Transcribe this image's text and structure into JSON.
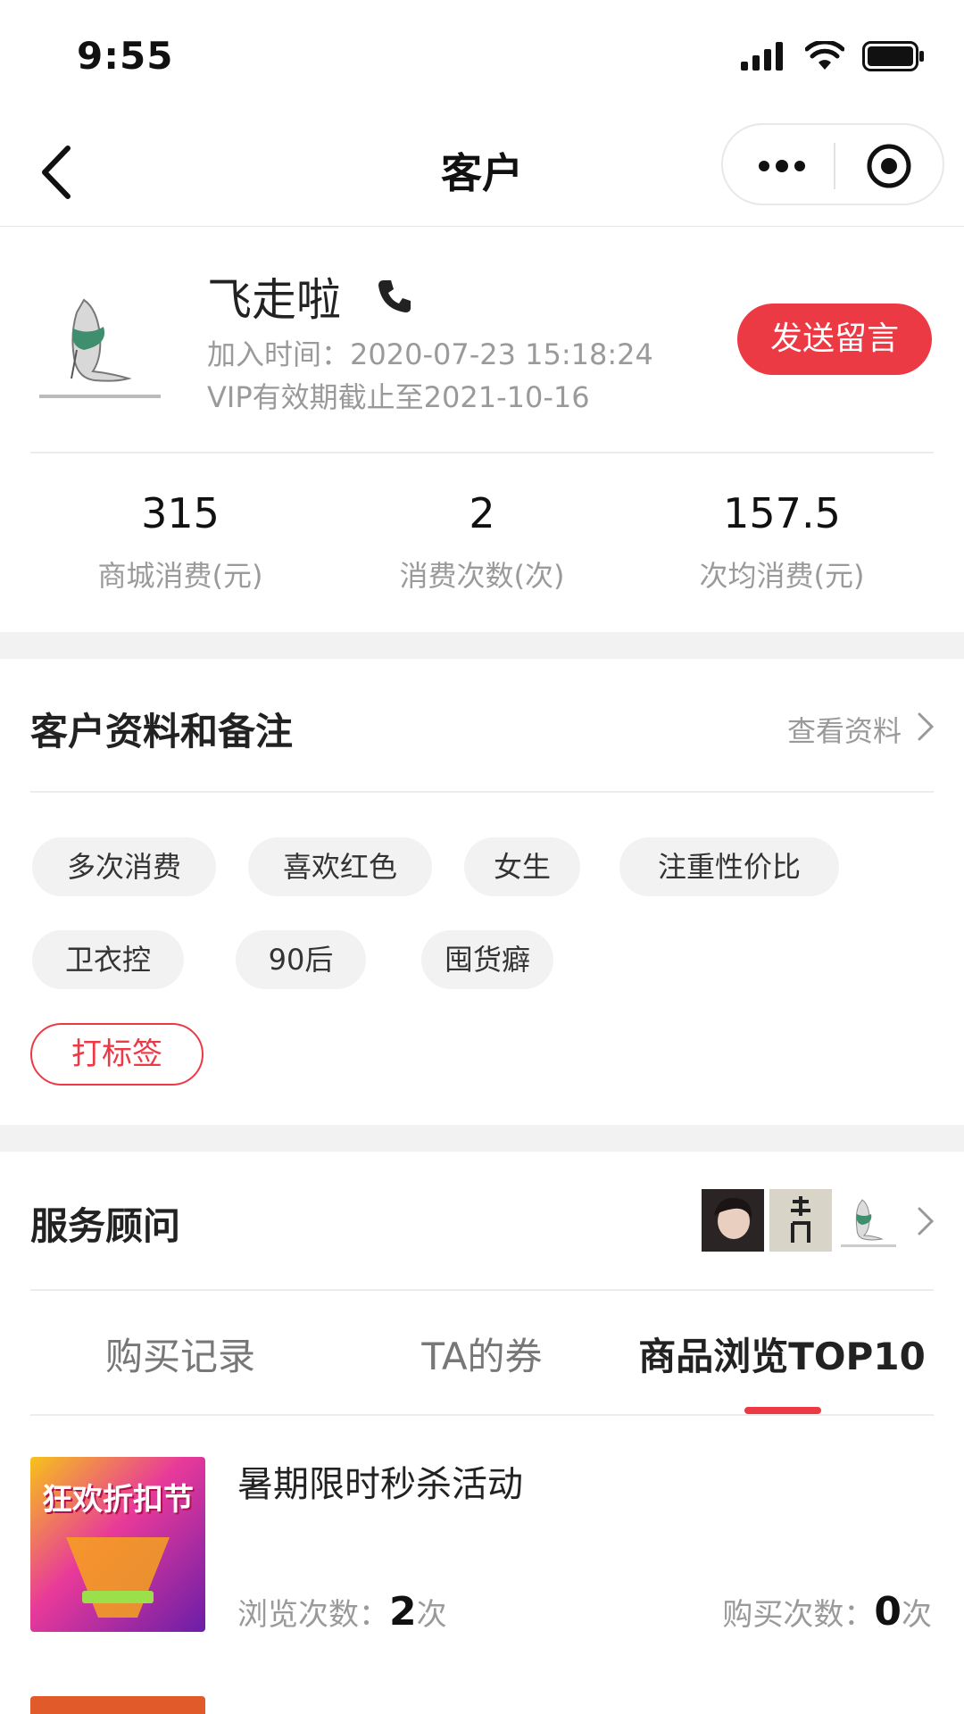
{
  "status_bar": {
    "time": "9:55"
  },
  "nav": {
    "title": "客户"
  },
  "profile": {
    "name": "飞走啦",
    "join_time": "加入时间：2020-07-23 15:18:24",
    "vip_expiry": "VIP有效期截止至2021-10-16",
    "message_button": "发送留言"
  },
  "stats": [
    {
      "value": "315",
      "label": "商城消费(元)"
    },
    {
      "value": "2",
      "label": "消费次数(次)"
    },
    {
      "value": "157.5",
      "label": "次均消费(元)"
    }
  ],
  "profile_section": {
    "title": "客户资料和备注",
    "link": "查看资料",
    "tags": [
      "多次消费",
      "喜欢红色",
      "女生",
      "注重性价比",
      "卫衣控",
      "90后",
      "囤货癖"
    ],
    "add_tag_button": "打标签"
  },
  "advisor_section": {
    "title": "服务顾问"
  },
  "tabs": [
    {
      "label": "购买记录",
      "active": false
    },
    {
      "label": "TA的券",
      "active": false
    },
    {
      "label": "商品浏览TOP10",
      "active": true
    }
  ],
  "products": [
    {
      "title": "暑期限时秒杀活动",
      "views_label": "浏览次数：",
      "views": "2",
      "views_unit": "次",
      "buys_label": "购买次数：",
      "buys": "0",
      "buys_unit": "次",
      "image_text": "狂欢折扣节"
    }
  ],
  "colors": {
    "accent": "#ec3a45",
    "muted_text": "#9a9a9a",
    "section_gap": "#f2f2f2"
  }
}
